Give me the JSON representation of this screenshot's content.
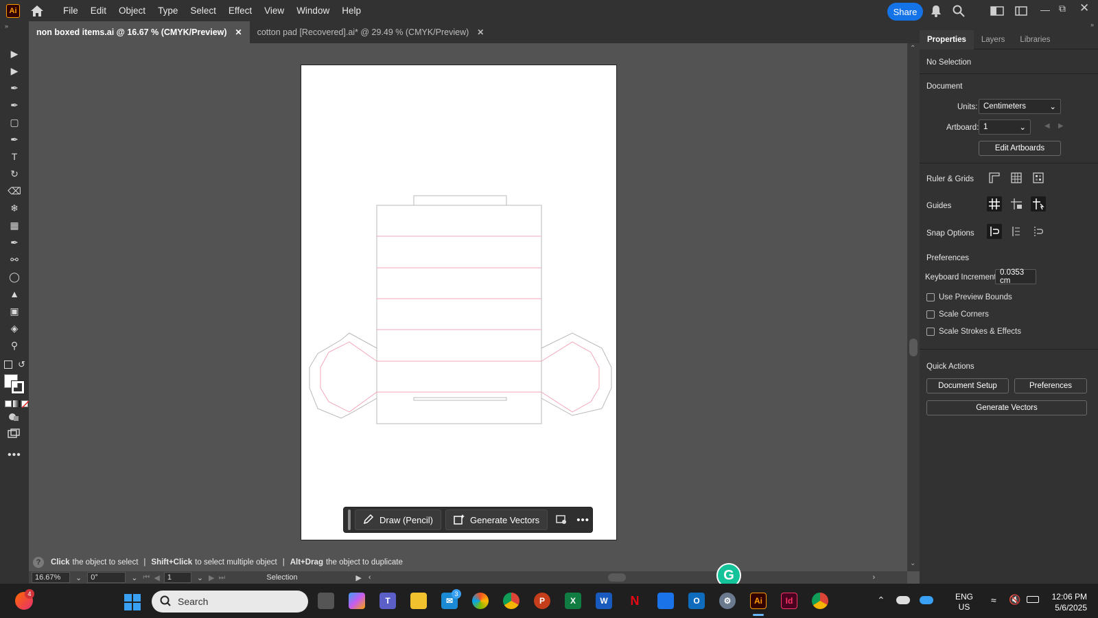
{
  "app": {
    "logo": "Ai",
    "menus": [
      "File",
      "Edit",
      "Object",
      "Type",
      "Select",
      "Effect",
      "View",
      "Window",
      "Help"
    ],
    "share_label": "Share"
  },
  "tabs": [
    {
      "label": "non boxed items.ai @ 16.67 % (CMYK/Preview)",
      "active": true
    },
    {
      "label": "cotton pad [Recovered].ai* @ 29.49 % (CMYK/Preview)",
      "active": false
    }
  ],
  "tools": [
    "selection-tool-icon",
    "direct-selection-tool-icon",
    "pen-tool-icon",
    "curvature-tool-icon",
    "rectangle-tool-icon",
    "paintbrush-tool-icon",
    "type-tool-icon",
    "rotate-tool-icon",
    "eraser-tool-icon",
    "lasso-tool-icon",
    "gradient-tool-icon",
    "eyedropper-tool-icon",
    "blend-tool-icon",
    "shape-builder-tool-icon",
    "live-paint-tool-icon",
    "artboard-tool-icon",
    "symbol-sprayer-tool-icon",
    "zoom-tool-icon"
  ],
  "panel": {
    "tabs": [
      "Properties",
      "Layers",
      "Libraries"
    ],
    "selection": "No Selection",
    "document": "Document",
    "units_label": "Units:",
    "units_value": "Centimeters",
    "artboard_label": "Artboard:",
    "artboard_value": "1",
    "edit_artboards": "Edit Artboards",
    "ruler_grids": "Ruler & Grids",
    "guides": "Guides",
    "snap_options": "Snap Options",
    "preferences": "Preferences",
    "keyboard_increment_label": "Keyboard Increment:",
    "keyboard_increment_value": "0.0353 cm",
    "checks": [
      "Use Preview Bounds",
      "Scale Corners",
      "Scale Strokes & Effects"
    ],
    "quick_actions": "Quick Actions",
    "document_setup": "Document Setup",
    "preferences_btn": "Preferences",
    "generate_vectors": "Generate Vectors"
  },
  "contextbar": {
    "draw": "Draw (Pencil)",
    "generate": "Generate Vectors"
  },
  "status": {
    "help_text_1a": "Click",
    "help_text_1b": "the object to select",
    "help_text_2a": "Shift+Click",
    "help_text_2b": "to select multiple object",
    "help_text_3a": "Alt+Drag",
    "help_text_3b": "the object to duplicate",
    "zoom": "16.67%",
    "rotation": "0°",
    "artboard_nav": "1",
    "tool_name": "Selection"
  },
  "taskbar": {
    "search": "Search",
    "lang": "ENG",
    "region": "US",
    "time": "12:06 PM",
    "date": "5/6/2025",
    "badge_left": "4",
    "badge_mail": "3"
  },
  "colors": {
    "accent": "#1473e6",
    "ai_orange": "#ff9a00",
    "cut_line": "#f3a6b8"
  }
}
